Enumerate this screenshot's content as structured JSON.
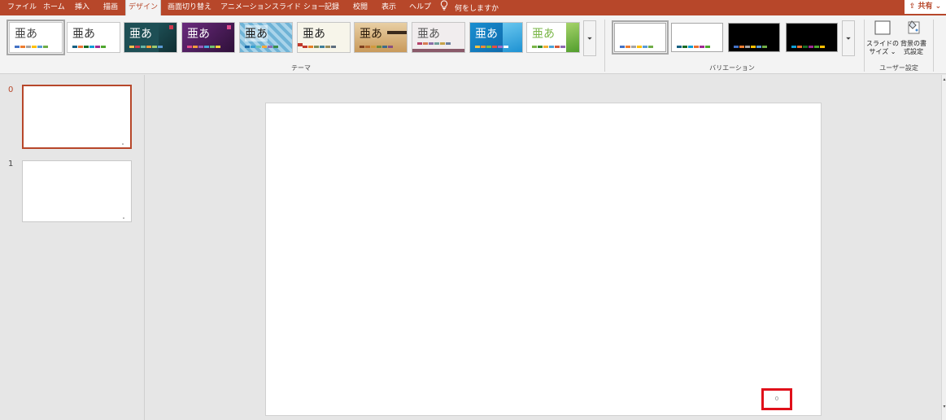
{
  "ribbon_tabs": [
    "ファイル",
    "ホーム",
    "挿入",
    "描画",
    "デザイン",
    "画面切り替え",
    "アニメーション",
    "スライド ショー",
    "記録",
    "校閲",
    "表示",
    "ヘルプ"
  ],
  "tell_me": {
    "label": "何をしますか",
    "icon": "lightbulb-icon"
  },
  "share": {
    "label": "共有",
    "icon": "share-icon"
  },
  "themes": {
    "glyph": "亜あ",
    "group_label": "テーマ",
    "more_icon": "gallery-more-icon"
  },
  "variants": {
    "group_label": "バリエーション",
    "more_icon": "gallery-more-icon"
  },
  "customize": {
    "group_label": "ユーザー設定",
    "slide_size": {
      "line1": "スライドの",
      "line2": "サイズ ⌄",
      "icon": "slide-size-icon"
    },
    "format_background": {
      "line1": "背景の書",
      "line2": "式設定",
      "icon": "format-background-icon"
    }
  },
  "thumbnails": [
    {
      "number": "0",
      "selected": true
    },
    {
      "number": "1",
      "selected": false
    }
  ],
  "slide": {
    "number_placeholder": "0"
  },
  "colors": {
    "accent": "#b7472a",
    "highlight_box": "#e0101a"
  }
}
